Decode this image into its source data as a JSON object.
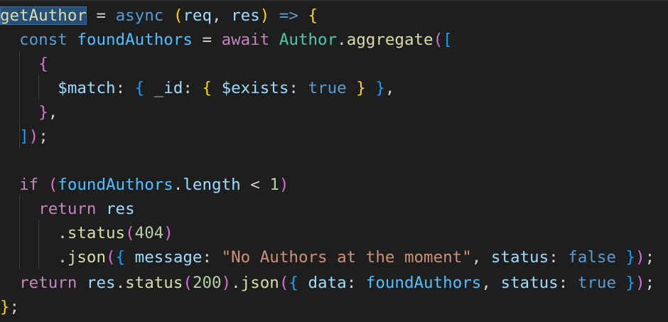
{
  "editor": {
    "theme_colors": {
      "background": "#1e1e1e",
      "function": "#dcdcaa",
      "keyword": "#569cd6",
      "control": "#c586c0",
      "variable": "#9cdcfe",
      "constant": "#4fc1ff",
      "string": "#ce9178",
      "number": "#b5cea8",
      "bracket_level_1": "#ffd700",
      "bracket_level_2": "#da70d6",
      "bracket_level_3": "#179fff",
      "selection_highlight": "#264f78"
    },
    "code": {
      "l1": {
        "fn": "getAuthor",
        "eq": " = ",
        "async": "async",
        "sp": " ",
        "paren_open": "(",
        "req": "req",
        "comma": ", ",
        "res": "res",
        "paren_close": ")",
        "arrow": " => ",
        "brace": "{"
      },
      "l2": {
        "indent": "  ",
        "const": "const",
        "sp": " ",
        "var": "foundAuthors",
        "eq": " = ",
        "await": "await",
        "sp2": " ",
        "cls": "Author",
        "dot": ".",
        "method": "aggregate",
        "paren": "(",
        "bracket": "["
      },
      "l3": {
        "indent": "    ",
        "brace": "{"
      },
      "l4": {
        "indent": "      ",
        "key": "$match",
        "colon": ": ",
        "b1": "{",
        "sp1": " ",
        "key2": "_id",
        "colon2": ": ",
        "b2": "{",
        "sp2": " ",
        "key3": "$exists",
        "colon3": ": ",
        "val": "true",
        "sp3": " ",
        "b2c": "}",
        "sp4": " ",
        "b1c": "}",
        "comma": ","
      },
      "l5": {
        "indent": "    ",
        "brace": "}",
        "comma": ","
      },
      "l6": {
        "indent": "  ",
        "bracket": "]",
        "paren": ")",
        "semi": ";"
      },
      "l8": {
        "indent": "  ",
        "if": "if",
        "sp": " ",
        "paren": "(",
        "var": "foundAuthors",
        "dot": ".",
        "prop": "length",
        "lt": " < ",
        "num": "1",
        "paren_close": ")"
      },
      "l9": {
        "indent": "    ",
        "ret": "return",
        "sp": " ",
        "res": "res"
      },
      "l10": {
        "indent": "      ",
        "dot": ".",
        "method": "status",
        "paren": "(",
        "num": "404",
        "paren_close": ")"
      },
      "l11": {
        "indent": "      ",
        "dot": ".",
        "method": "json",
        "paren": "(",
        "brace": "{",
        "sp": " ",
        "key": "message",
        "colon": ": ",
        "str": "\"No Authors at the moment\"",
        "comma": ", ",
        "key2": "status",
        "colon2": ": ",
        "val": "false",
        "sp2": " ",
        "brace_close": "}",
        "paren_close": ")",
        "semi": ";"
      },
      "l12": {
        "indent": "  ",
        "ret": "return",
        "sp": " ",
        "res": "res",
        "dot": ".",
        "method": "status",
        "paren": "(",
        "num": "200",
        "paren_close": ")",
        "dot2": ".",
        "method2": "json",
        "paren2": "(",
        "brace": "{",
        "sp2": " ",
        "key": "data",
        "colon": ": ",
        "var": "foundAuthors",
        "comma": ", ",
        "key2": "status",
        "colon2": ": ",
        "val": "true",
        "sp3": " ",
        "brace_close": "}",
        "paren_close2": ")",
        "semi": ";"
      },
      "l13": {
        "brace": "}",
        "semi": ";"
      }
    }
  }
}
